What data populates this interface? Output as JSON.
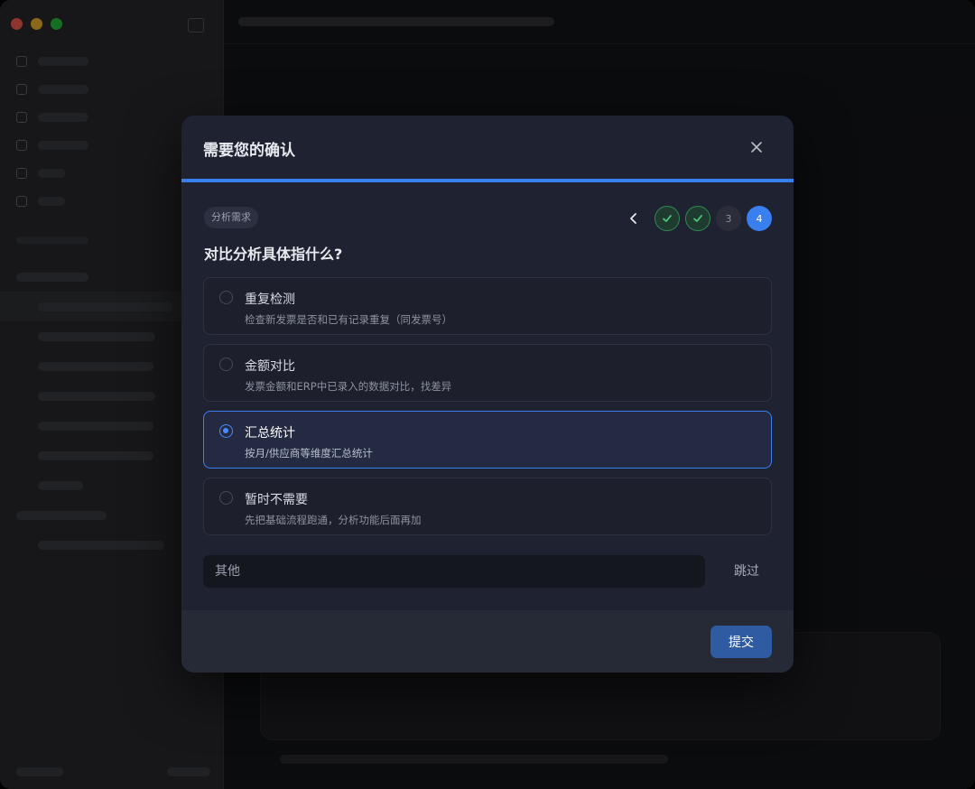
{
  "dialog": {
    "title": "需要您的确认",
    "tag": "分析需求",
    "question": "对比分析具体指什么?",
    "steps": {
      "current_step": 4,
      "total_steps": 4,
      "step3_label": "3",
      "step4_label": "4"
    },
    "options": [
      {
        "label": "重复检测",
        "description": "检查新发票是否和已有记录重复（同发票号）",
        "selected": false
      },
      {
        "label": "金额对比",
        "description": "发票金额和ERP中已录入的数据对比，找差异",
        "selected": false
      },
      {
        "label": "汇总统计",
        "description": "按月/供应商等维度汇总统计",
        "selected": true
      },
      {
        "label": "暂时不需要",
        "description": "先把基础流程跑通，分析功能后面再加",
        "selected": false
      }
    ],
    "other_placeholder": "其他",
    "skip_label": "跳过",
    "submit_label": "提交"
  },
  "colors": {
    "accent": "#3a7ff0",
    "success": "#2f8a55",
    "submit": "#2f5ba3",
    "modal_bg": "#1f2230"
  }
}
